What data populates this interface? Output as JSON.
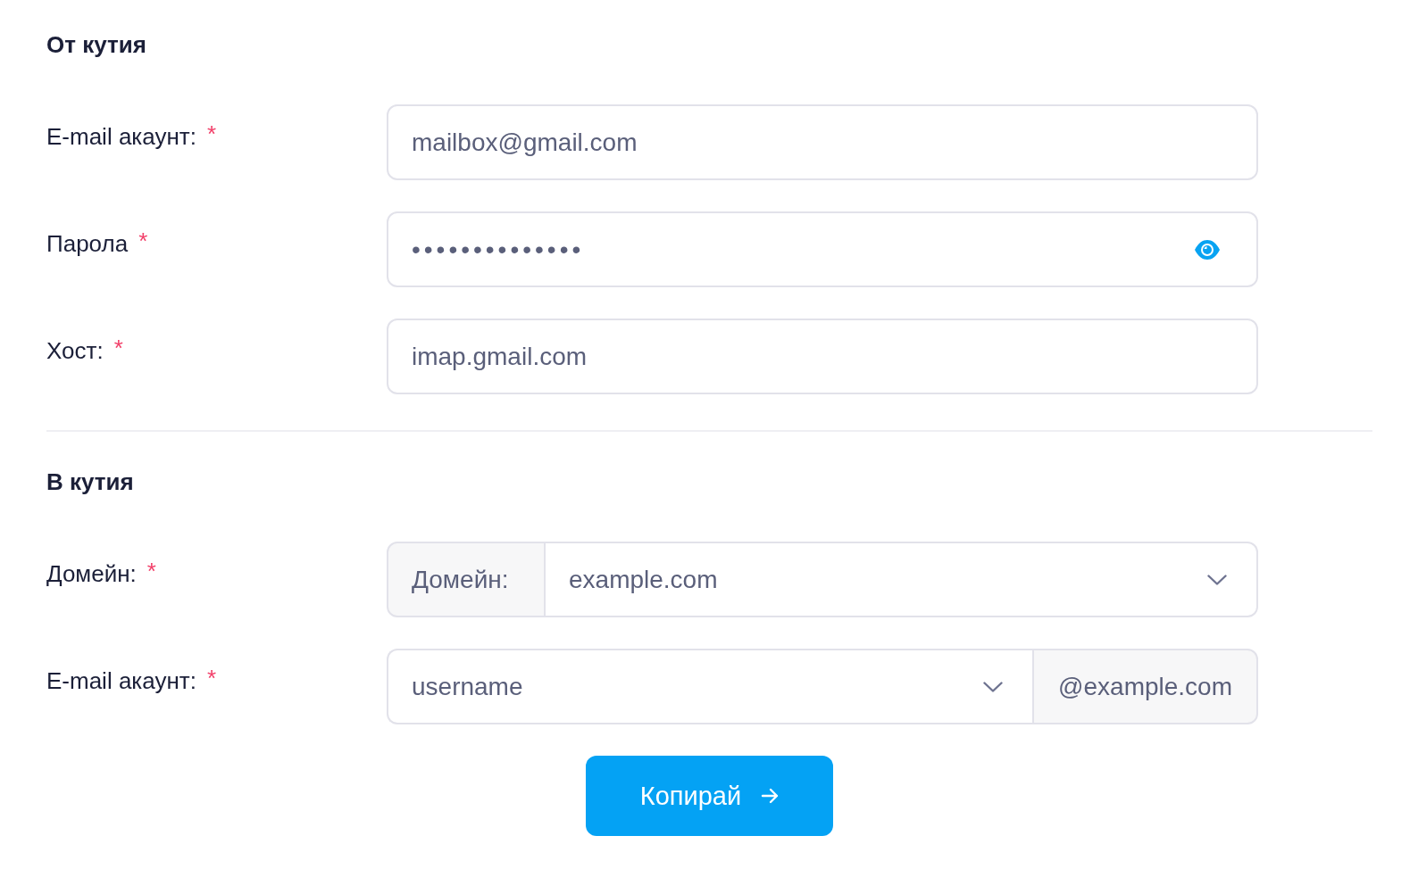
{
  "sections": [
    {
      "title": "От кутия",
      "fields": [
        {
          "kind": "text",
          "label": "E-mail акаунт:",
          "required_mark": "*",
          "value": "mailbox@gmail.com"
        },
        {
          "kind": "password",
          "label": "Парола",
          "required_mark": "*",
          "value": "••••••••••••••"
        },
        {
          "kind": "text",
          "label": "Хост:",
          "required_mark": "*",
          "value": "imap.gmail.com"
        }
      ]
    },
    {
      "title": "В кутия",
      "fields": [
        {
          "kind": "prefixed-select",
          "label": "Домейн:",
          "required_mark": "*",
          "prefix": "Домейн:",
          "value": "example.com"
        },
        {
          "kind": "select-suffix",
          "label": "E-mail акаунт:",
          "required_mark": "*",
          "value": "username",
          "suffix": "@example.com"
        }
      ]
    }
  ],
  "submit": {
    "label": "Копирай"
  }
}
